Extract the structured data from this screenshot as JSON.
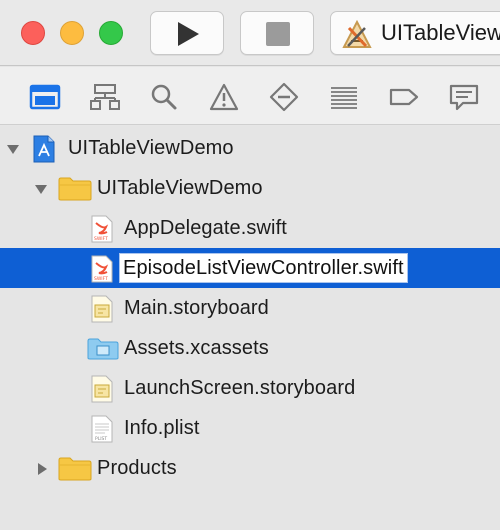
{
  "toolbar": {
    "scheme_label": "UITableViewDemo",
    "icons": [
      "close-light",
      "minimize-light",
      "zoom-light",
      "play-icon",
      "stop-icon",
      "xcode-app-icon"
    ]
  },
  "navigator": {
    "tabs": [
      "project-navigator-icon",
      "symbol-navigator-icon",
      "find-navigator-icon",
      "issue-navigator-icon",
      "test-navigator-icon",
      "debug-navigator-icon",
      "breakpoint-navigator-icon",
      "report-navigator-icon"
    ],
    "active_tab": "project-navigator-icon"
  },
  "tree": {
    "project": {
      "label": "UITableViewDemo"
    },
    "group": {
      "label": "UITableViewDemo"
    },
    "files": [
      {
        "label": "AppDelegate.swift",
        "icon": "swift-file-icon"
      },
      {
        "label": "EpisodeListViewController.swift",
        "icon": "swift-file-icon",
        "selected": true,
        "editing": true
      },
      {
        "label": "Main.storyboard",
        "icon": "storyboard-file-icon"
      },
      {
        "label": "Assets.xcassets",
        "icon": "asset-catalog-icon"
      },
      {
        "label": "LaunchScreen.storyboard",
        "icon": "storyboard-file-icon"
      },
      {
        "label": "Info.plist",
        "icon": "plist-file-icon"
      }
    ],
    "products": {
      "label": "Products"
    }
  },
  "colors": {
    "selection": "#0e5fd4",
    "accent": "#1a73e8",
    "swift": "#f05138",
    "folder": "#f6c744"
  }
}
